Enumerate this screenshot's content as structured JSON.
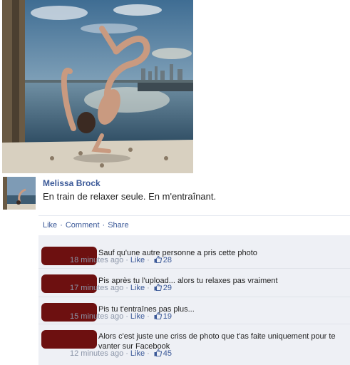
{
  "post": {
    "author": "Melissa Brock",
    "text": "En train de relaxer seule. En m'entraînant."
  },
  "actions": {
    "like": "Like",
    "comment": "Comment",
    "share": "Share"
  },
  "comments": [
    {
      "text": "Sauf qu'une autre personne a pris cette photo",
      "time": "18 minutes ago",
      "like": "Like",
      "count": "28"
    },
    {
      "text": "Pis après tu l'upload... alors tu relaxes pas vraiment",
      "time": "17 minutes ago",
      "like": "Like",
      "count": "29"
    },
    {
      "text": "Pis tu t'entraînes pas plus...",
      "time": "15 minutes ago",
      "like": "Like",
      "count": "19"
    },
    {
      "text": "Alors c'est juste une criss de photo que t'as faite uniquement pour te vanter sur Facebook",
      "time": "12 minutes ago",
      "like": "Like",
      "count": "45"
    }
  ],
  "icons": {
    "like_count": "thumbs-up-icon"
  },
  "colors": {
    "link": "#3b5998",
    "redaction": "#6d1010",
    "comment_bg": "#eef0f5"
  }
}
